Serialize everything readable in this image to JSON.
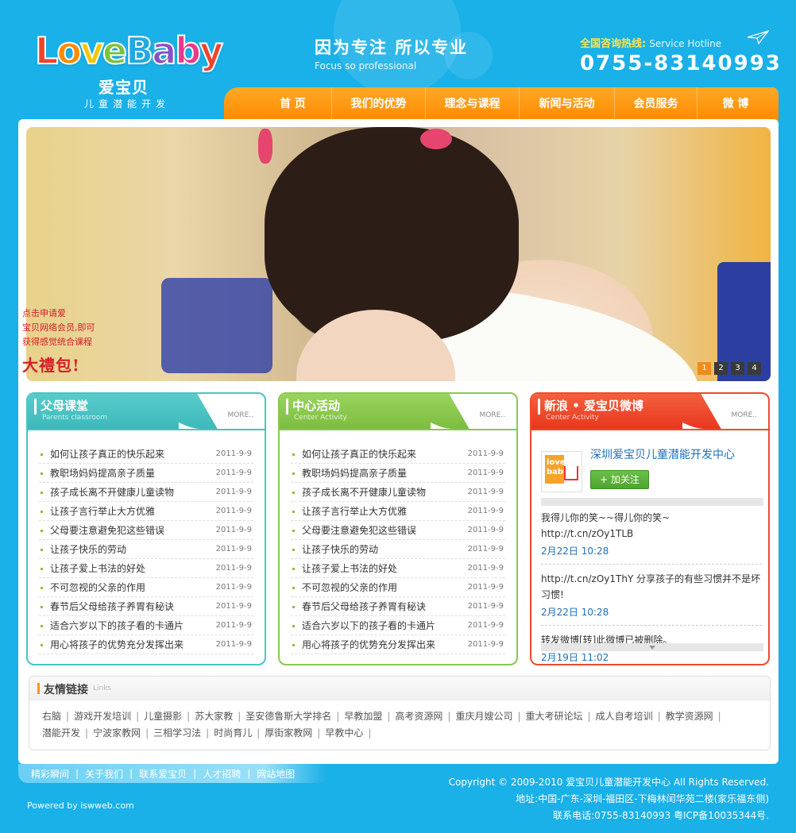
{
  "header": {
    "logo_word": "LoveBaby",
    "logo_cn": "爱宝贝",
    "logo_sub": "儿童潜能开发",
    "slogan_cn": "因为专注 所以专业",
    "slogan_en": "Focus so professional",
    "hotline_label": "全国咨询热线:",
    "hotline_en": "Service Hotline",
    "hotline_number": "0755-83140993"
  },
  "nav": [
    {
      "label": "首 页"
    },
    {
      "label": "我们的优势"
    },
    {
      "label": "理念与课程"
    },
    {
      "label": "新闻与活动"
    },
    {
      "label": "会员服务"
    },
    {
      "label": "微 博"
    }
  ],
  "banner": {
    "promo_lines": [
      "点击申请爱",
      "宝贝网络会员,即可",
      "获得感觉统合课程"
    ],
    "promo_big": "大禮包!",
    "pages": [
      "1",
      "2",
      "3",
      "4"
    ],
    "active_page": 1
  },
  "boxes": [
    {
      "title": "父母课堂",
      "sub": "Parents classroom",
      "more": "MORE..",
      "items": [
        {
          "text": "如何让孩子真正的快乐起来",
          "date": "2011-9-9"
        },
        {
          "text": "教职场妈妈提高亲子质量",
          "date": "2011-9-9"
        },
        {
          "text": "孩子成长离不开健康儿童读物",
          "date": "2011-9-9"
        },
        {
          "text": "让孩子言行举止大方优雅",
          "date": "2011-9-9"
        },
        {
          "text": "父母要注意避免犯这些错误",
          "date": "2011-9-9"
        },
        {
          "text": "让孩子快乐的劳动",
          "date": "2011-9-9"
        },
        {
          "text": "让孩子爱上书法的好处",
          "date": "2011-9-9"
        },
        {
          "text": "不可忽视的父亲的作用",
          "date": "2011-9-9"
        },
        {
          "text": "春节后父母给孩子养胃有秘诀",
          "date": "2011-9-9"
        },
        {
          "text": "适合六岁以下的孩子看的卡通片",
          "date": "2011-9-9"
        },
        {
          "text": "用心将孩子的优势充分发挥出来",
          "date": "2011-9-9"
        }
      ]
    },
    {
      "title": "中心活动",
      "sub": "Center Activity",
      "more": "MORE..",
      "items": [
        {
          "text": "如何让孩子真正的快乐起来",
          "date": "2011-9-9"
        },
        {
          "text": "教职场妈妈提高亲子质量",
          "date": "2011-9-9"
        },
        {
          "text": "孩子成长离不开健康儿童读物",
          "date": "2011-9-9"
        },
        {
          "text": "让孩子言行举止大方优雅",
          "date": "2011-9-9"
        },
        {
          "text": "父母要注意避免犯这些错误",
          "date": "2011-9-9"
        },
        {
          "text": "让孩子快乐的劳动",
          "date": "2011-9-9"
        },
        {
          "text": "让孩子爱上书法的好处",
          "date": "2011-9-9"
        },
        {
          "text": "不可忽视的父亲的作用",
          "date": "2011-9-9"
        },
        {
          "text": "春节后父母给孩子养胃有秘诀",
          "date": "2011-9-9"
        },
        {
          "text": "适合六岁以下的孩子看的卡通片",
          "date": "2011-9-9"
        },
        {
          "text": "用心将孩子的优势充分发挥出来",
          "date": "2011-9-9"
        }
      ]
    }
  ],
  "weibo": {
    "title": "新浪 • 爱宝贝微博",
    "sub": "Center Activity",
    "more": "MORE..",
    "avatar_text": "love baby",
    "name": "深圳爱宝贝儿童潜能开发中心",
    "follow_label": "+ 加关注",
    "posts": [
      {
        "text": "我得儿你的笑~~得儿你的笑~ http://t.cn/zOy1TLB",
        "time": "2月22日 10:28"
      },
      {
        "text": "http://t.cn/zOy1ThY 分享孩子的有些习惯并不是坏习惯!",
        "time": "2月22日 10:28"
      },
      {
        "text": "转发微博[转]此微博已被删除。",
        "time": "2月19日 11:02"
      }
    ]
  },
  "links": {
    "title": "友情链接",
    "en": "Links",
    "row1": [
      "右脑",
      "游戏开发培训",
      "儿童摄影",
      "苏大家教",
      "圣安德鲁斯大学排名",
      "早教加盟",
      "高考资源网",
      "重庆月嫂公司",
      "重大考研论坛",
      "成人自考培训",
      "教学资源网"
    ],
    "row2": [
      "潜能开发",
      "宁波家教网",
      "三相学习法",
      "时尚育儿",
      "厚街家教网",
      "早教中心"
    ]
  },
  "footer": {
    "nav": [
      "精彩瞬间",
      "关于我们",
      "联系爱宝贝",
      "人才招聘",
      "网站地图"
    ],
    "powered": "Powered by iswweb.com",
    "copyright": "Copyright © 2009-2010 爱宝贝儿童潜能开发中心 All Rights Reserved.",
    "address": "地址:中国-广东-深圳-福田区-下梅林闰华苑二楼(家乐福东侧)",
    "contact": "联系电话:0755-83140993 粤ICP备10035344号."
  },
  "colors": {
    "background": "#1ab0e8",
    "nav": "#ff9a12",
    "box_teal": "#4cc3c4",
    "box_green": "#8ac850",
    "box_red": "#f04b2e",
    "link_blue": "#1d6fb8"
  }
}
